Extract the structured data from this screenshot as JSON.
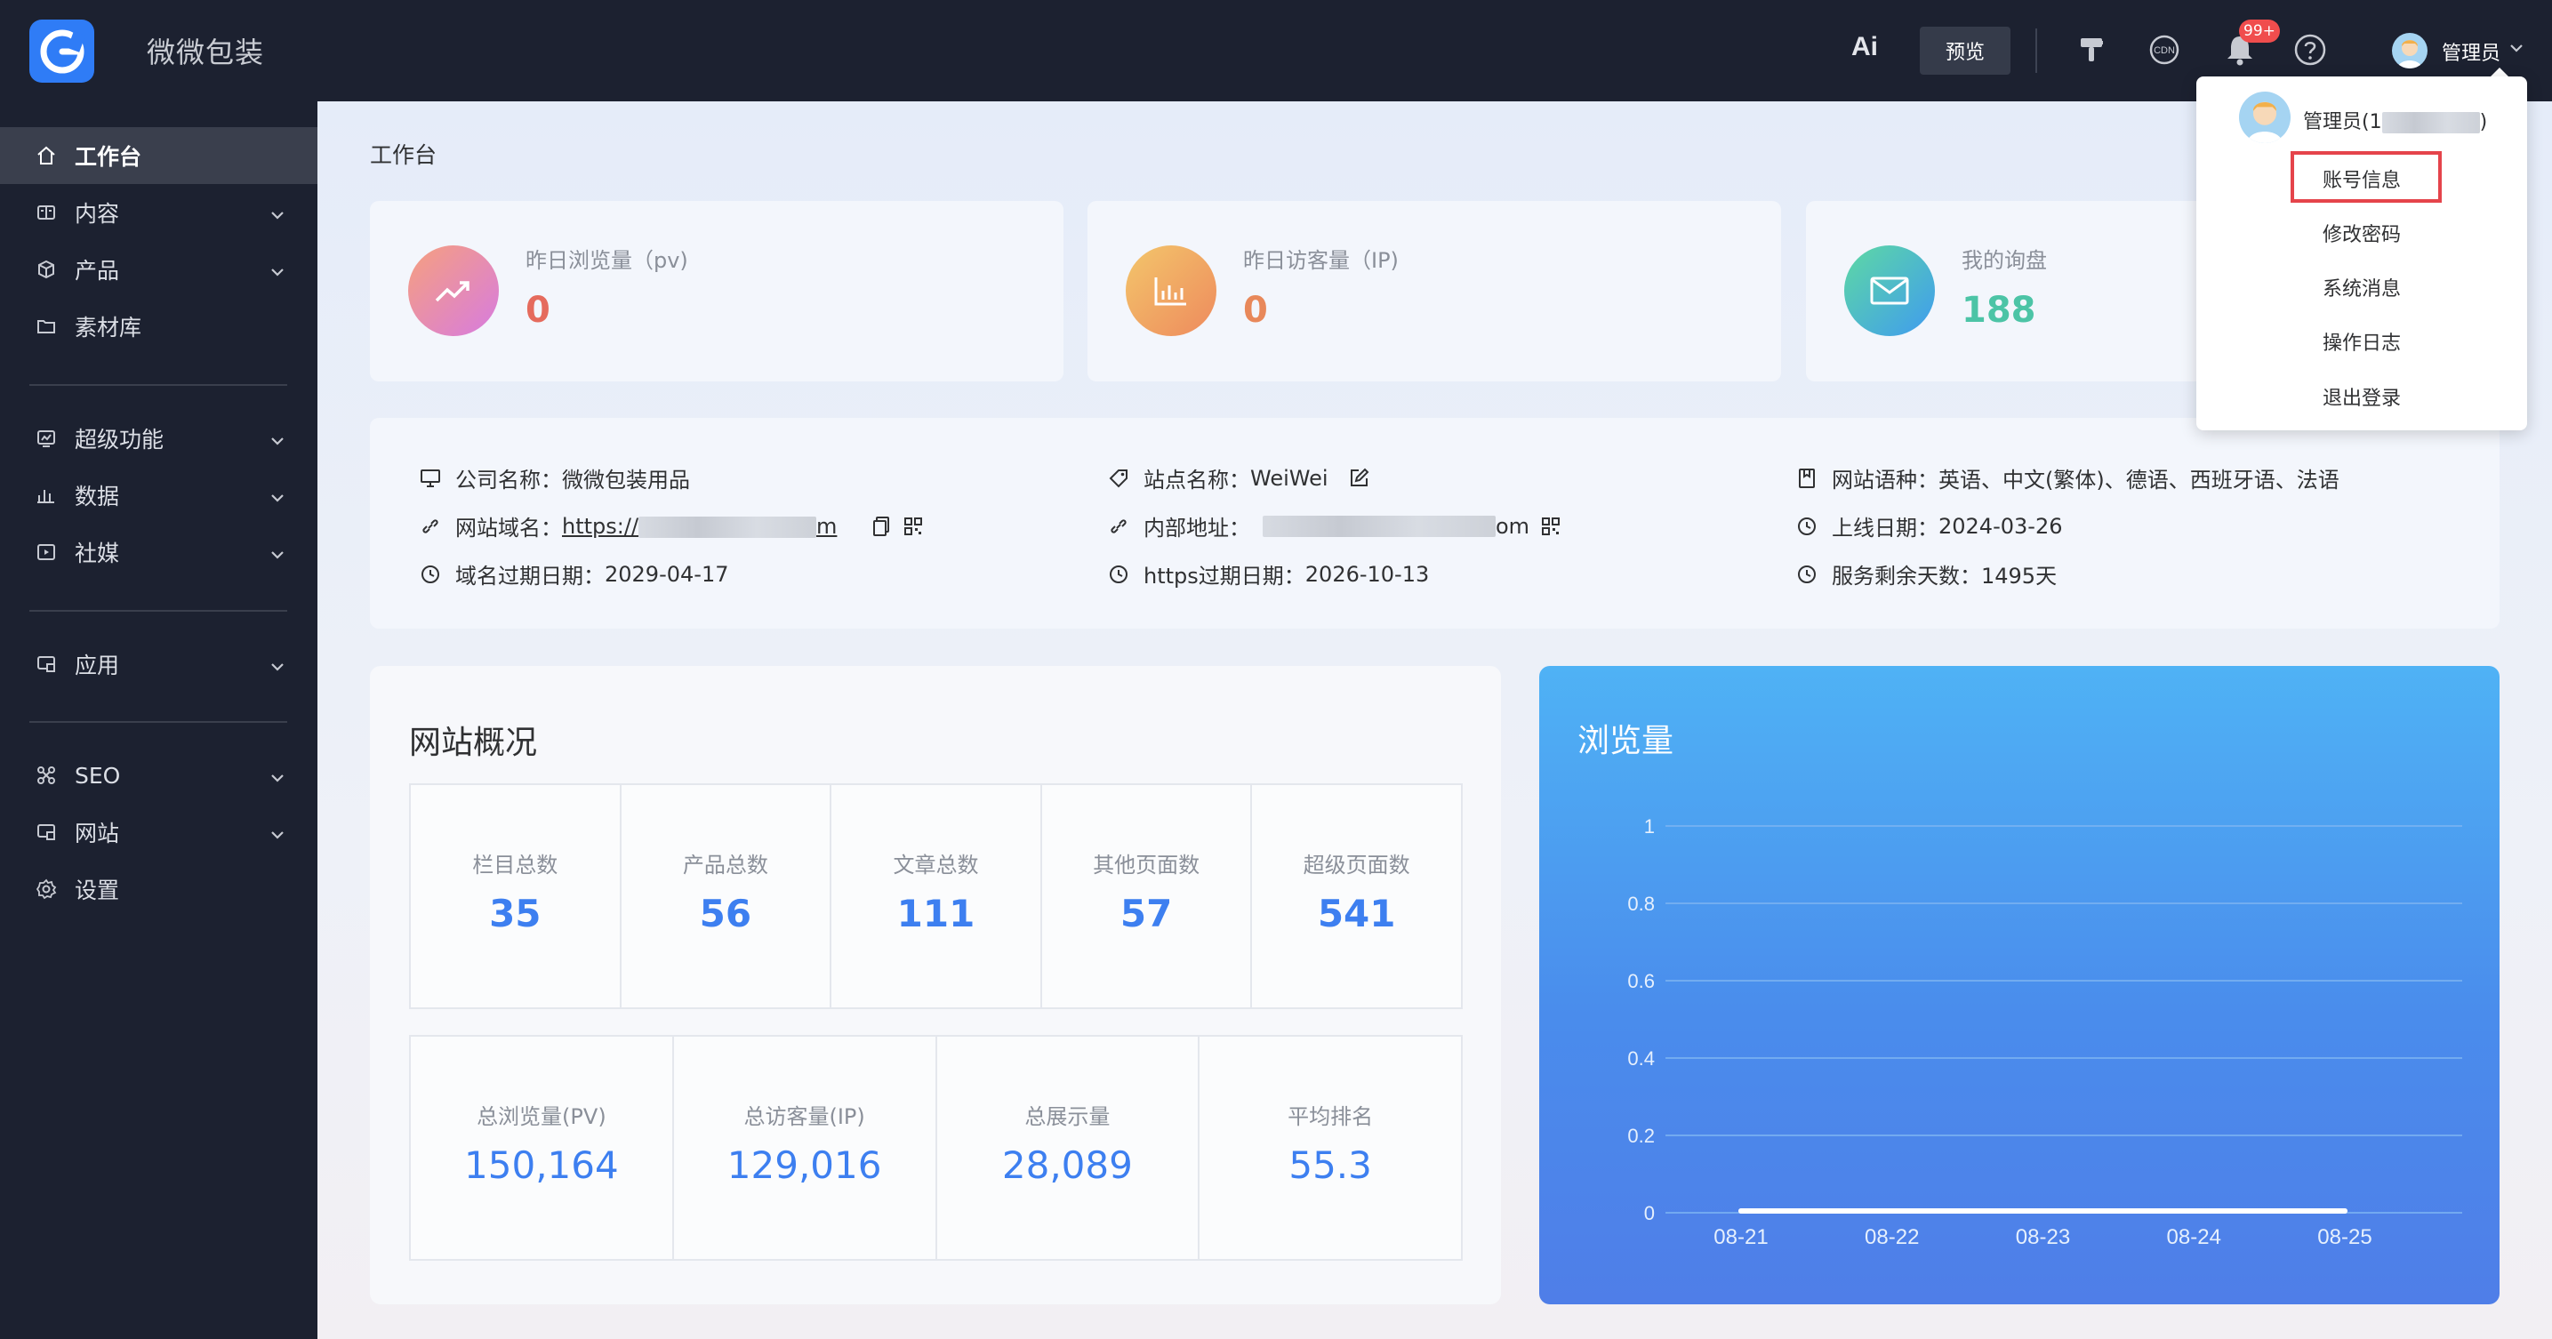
{
  "app": {
    "title": "微微包装"
  },
  "topbar": {
    "ai_label": "Ai",
    "preview_label": "预览",
    "notification_badge": "99+",
    "username": "管理员",
    "icons": [
      "brush-icon",
      "cdn-icon",
      "bell-icon",
      "help-icon"
    ],
    "cdn_text": "CDN"
  },
  "sidebar": {
    "items": [
      {
        "label": "工作台",
        "icon": "home-icon",
        "active": true
      },
      {
        "label": "内容",
        "icon": "content-icon",
        "expandable": true
      },
      {
        "label": "产品",
        "icon": "product-icon",
        "expandable": true
      },
      {
        "label": "素材库",
        "icon": "folder-icon"
      },
      {
        "label": "超级功能",
        "icon": "super-icon",
        "expandable": true
      },
      {
        "label": "数据",
        "icon": "data-icon",
        "expandable": true
      },
      {
        "label": "社媒",
        "icon": "social-icon",
        "expandable": true
      },
      {
        "label": "应用",
        "icon": "app-icon",
        "expandable": true
      },
      {
        "label": "SEO",
        "icon": "seo-icon",
        "expandable": true
      },
      {
        "label": "网站",
        "icon": "website-icon",
        "expandable": true
      },
      {
        "label": "设置",
        "icon": "gear-icon"
      }
    ]
  },
  "page": {
    "title": "工作台"
  },
  "stats": [
    {
      "label": "昨日浏览量（pv)",
      "value": "0",
      "color": "#e56b5d"
    },
    {
      "label": "昨日访客量（IP)",
      "value": "0",
      "color": "#e8885a"
    },
    {
      "label": "我的询盘",
      "value": "188",
      "color": "#4cc4a6"
    }
  ],
  "info": {
    "company_label": "公司名称：",
    "company_value": "微微包装用品",
    "domain_label": "网站域名：",
    "domain_prefix": "https://",
    "domain_suffix": "m",
    "domain_expiry_label": "域名过期日期：",
    "domain_expiry_value": "2029-04-17",
    "site_name_label": "站点名称：",
    "site_name_value": "WeiWei",
    "internal_label": "内部地址：",
    "internal_suffix": "om",
    "https_expiry_label": "https过期日期：",
    "https_expiry_value": "2026-10-13",
    "languages_label": "网站语种：",
    "languages_value": "英语、中文(繁体)、德语、西班牙语、法语",
    "online_label": "上线日期：",
    "online_value": "2024-03-26",
    "remaining_label": "服务剩余天数：",
    "remaining_value": "1495天"
  },
  "overview": {
    "title": "网站概况",
    "row1": [
      {
        "label": "栏目总数",
        "value": "35"
      },
      {
        "label": "产品总数",
        "value": "56"
      },
      {
        "label": "文章总数",
        "value": "111"
      },
      {
        "label": "其他页面数",
        "value": "57"
      },
      {
        "label": "超级页面数",
        "value": "541"
      }
    ],
    "row2": [
      {
        "label": "总浏览量(PV)",
        "value": "150,164"
      },
      {
        "label": "总访客量(IP)",
        "value": "129,016"
      },
      {
        "label": "总展示量",
        "value": "28,089"
      },
      {
        "label": "平均排名",
        "value": "55.3"
      }
    ]
  },
  "chart_title": "浏览量",
  "chart_data": {
    "type": "line",
    "title": "浏览量",
    "categories": [
      "08-21",
      "08-22",
      "08-23",
      "08-24",
      "08-25"
    ],
    "series": [
      {
        "values": [
          0,
          0,
          0,
          0,
          0
        ]
      }
    ],
    "yticks": [
      "0",
      "0.2",
      "0.4",
      "0.6",
      "0.8",
      "1"
    ],
    "ylim": [
      0,
      1
    ],
    "grid": true,
    "colors": {
      "line": "#ffffff",
      "grid": "#7fb6f2",
      "text": "#e6f0fd"
    }
  },
  "dropdown": {
    "name_prefix": "管理员(1",
    "name_suffix": ")",
    "items": [
      "账号信息",
      "修改密码",
      "系统消息",
      "操作日志",
      "退出登录"
    ],
    "highlighted": "账号信息",
    "highlight_color": "#e5444b"
  }
}
